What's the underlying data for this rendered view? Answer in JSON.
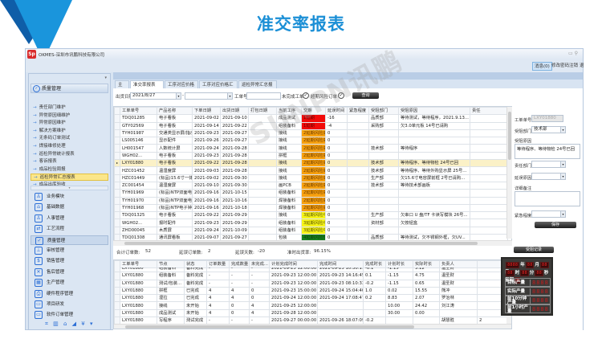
{
  "page_title": "准交率报表",
  "watermark": "SUNPN讯鹏",
  "app": {
    "logo": "Sp",
    "title": "OKMES-深圳市讯鹏科技有限公司",
    "window_controls": "▭ ⚲"
  },
  "menu": [
    {
      "label": "消息(0)"
    },
    {
      "label": "修改密码"
    },
    {
      "label": "注销"
    },
    {
      "label": "退"
    }
  ],
  "sidebar": {
    "pin": "▾",
    "group_label": "质量管理",
    "items": [
      {
        "label": "责任部门维护"
      },
      {
        "label": "异常原因细维护"
      },
      {
        "label": "异常原因维护"
      },
      {
        "label": "解决方案维护"
      },
      {
        "label": "无条码订单测试"
      },
      {
        "label": "焊接维修处理"
      },
      {
        "label": "巡检异常统计报表"
      },
      {
        "label": "客诉报表"
      },
      {
        "label": "成品检验周报"
      },
      {
        "label": "巡检异常汇总报表"
      },
      {
        "label": "成品出库验收"
      }
    ],
    "selected_item": "巡检异常汇总报表",
    "modules": [
      {
        "label": "业务模块",
        "icon": "user-icon",
        "glyph": "♙"
      },
      {
        "label": "基础数据",
        "icon": "home-icon",
        "glyph": "⌂"
      },
      {
        "label": "人事管理",
        "icon": "people-icon",
        "glyph": "♙"
      },
      {
        "label": "工艺流程",
        "icon": "flow-icon",
        "glyph": "⇄"
      },
      {
        "label": "质量管理",
        "icon": "check-icon",
        "glyph": "✓"
      },
      {
        "label": "审核管理",
        "icon": "stamp-icon",
        "glyph": "⊥"
      },
      {
        "label": "销售管理",
        "icon": "money-bag-icon",
        "glyph": "$"
      },
      {
        "label": "售后管理",
        "icon": "tools-icon",
        "glyph": "✕"
      },
      {
        "label": "生产管理",
        "icon": "grid-icon",
        "glyph": "▦"
      },
      {
        "label": "硬件程序管理",
        "icon": "printer-icon",
        "glyph": "⎙"
      },
      {
        "label": "项目研发",
        "icon": "monitor-code-icon",
        "glyph": "▭"
      },
      {
        "label": "软件订单管理",
        "icon": "monitor-icon",
        "glyph": "▭"
      }
    ],
    "bottom_icons": "⌗ ▥ ⌂ ◢ ¥ ▾"
  },
  "tabs": [
    {
      "label": "主页",
      "closable": false
    },
    {
      "label": "准交率报表2",
      "closable": true,
      "active": true
    },
    {
      "label": "工序对应价格",
      "closable": true
    },
    {
      "label": "工序对应价格汇总",
      "closable": true
    },
    {
      "label": "巡检异常汇总报表",
      "closable": true
    }
  ],
  "filter": {
    "ship_date_label": "出货日期",
    "ship_date_from": "2021/8/27",
    "ship_date_to": "",
    "order_no_label": "工单号",
    "order_no_value": "",
    "incomplete_label": "未完成工单",
    "incomplete_checked": true,
    "overdue_label": "超期风险订单",
    "overdue_checked": true,
    "query_button": "查询"
  },
  "orders_table": {
    "columns": [
      "工单单号",
      "产品名称",
      "下单日期",
      "出货日期",
      "打包日期",
      "当前工序",
      "交期",
      "延误时间",
      "紧急程度",
      "受阻部门",
      "受阻原因",
      "责任"
    ],
    "rows": [
      {
        "cells": [
          "TDQ01285",
          "电子看板",
          "2021-09-02",
          "2021-09-10",
          "",
          "成品测试",
          "1延期",
          "-16",
          "",
          "品质部",
          "等待测试，等待程序，2021.9.13...",
          ""
        ],
        "level": 1
      },
      {
        "cells": [
          "GTY02569",
          "电子看板",
          "2021-09-14",
          "2021-09-22",
          "",
          "组装备料",
          "1延期",
          "-4",
          "",
          "采购部",
          "欠3.0单元板  14号已请购",
          ""
        ],
        "level": 1
      },
      {
        "cells": [
          "TYH01987",
          "交通类显示屏/指示...",
          "2021-09-23",
          "2021-09-27",
          "",
          "接线",
          "2延期风险高",
          "0",
          "",
          "",
          "",
          ""
        ],
        "level": 2
      },
      {
        "cells": [
          "LS005146",
          "显示配件",
          "2021-09-26",
          "2021-09-27",
          "",
          "接线",
          "2延期风险高",
          "0",
          "",
          "",
          "",
          ""
        ],
        "level": 2
      },
      {
        "cells": [
          "LH001547",
          "人数统计屏",
          "2021-09-24",
          "2021-09-28",
          "",
          "接线",
          "2延期风险高",
          "0",
          "",
          "技术部",
          "等待程序",
          ""
        ],
        "level": 2
      },
      {
        "cells": [
          "WGH02...",
          "电子看板",
          "2021-09-23",
          "2021-09-28",
          "",
          "拼框",
          "2延期风险高",
          "0",
          "",
          "",
          "",
          ""
        ],
        "level": 2
      },
      {
        "cells": [
          "LXY01880",
          "电子看板",
          "2021-09-22",
          "2021-09-28",
          "",
          "接线",
          "2延期风险高",
          "0",
          "",
          "技术部",
          "等待程序、等待物检 24号已回",
          ""
        ],
        "level": 2,
        "selected": true
      },
      {
        "cells": [
          "HZC01452",
          "温湿度屏",
          "2021-09-03",
          "2021-09-28",
          "",
          "接线",
          "2延期风险高",
          "0",
          "",
          "技术部",
          "等待程序、等待外购显示屏 25号...",
          ""
        ],
        "level": 2
      },
      {
        "cells": [
          "HZC01449",
          "(标品)15.6寸一体...",
          "2021-09-02",
          "2021-09-30",
          "",
          "接线",
          "2延期风险高",
          "0",
          "",
          "生产部",
          "欠15.6寸电容屏前框  2号已请购...",
          ""
        ],
        "level": 2
      },
      {
        "cells": [
          "ZC001454",
          "温湿度屏",
          "2021-09-10",
          "2021-09-30",
          "",
          "画PCB",
          "2延期风险高",
          "0",
          "",
          "技术部",
          "等待技术部画板",
          ""
        ],
        "level": 2
      },
      {
        "cells": [
          "TYH01969",
          "(标品)NTP双面电...",
          "2021-09-16",
          "2021-10-15",
          "",
          "组装备料",
          "2延期风险高",
          "0",
          "",
          "",
          "",
          ""
        ],
        "level": 2
      },
      {
        "cells": [
          "TYH01970",
          "(标品)NTP双面电...",
          "2021-09-16",
          "2021-10-16",
          "",
          "焊接备料",
          "2延期风险高",
          "0",
          "",
          "",
          "",
          ""
        ],
        "level": 2
      },
      {
        "cells": [
          "TYH01968",
          "(标品)NTP电子钟...",
          "2021-09-16",
          "2021-10-18",
          "",
          "焊接备料",
          "2延期风险高",
          "0",
          "",
          "",
          "",
          ""
        ],
        "level": 2
      },
      {
        "cells": [
          "TDQ01325",
          "电子看板",
          "2021-09-22",
          "2021-09-29",
          "",
          "接线",
          "3延期风险中",
          "0",
          "",
          "生产部",
          "欠串口 U 盘/TF 卡读写模块  26号...",
          ""
        ],
        "level": 3
      },
      {
        "cells": [
          "WGH02...",
          "报时配件",
          "2021-09-23",
          "2021-09-29",
          "",
          "组装备料",
          "3延期风险中",
          "0",
          "",
          "资材部",
          "欠按钮盒",
          ""
        ],
        "level": 3
      },
      {
        "cells": [
          "ZHD00045",
          "木质屏",
          "2021-09-24",
          "2021-10-09",
          "",
          "组装备料",
          "3延期风险中",
          "0",
          "",
          "",
          "",
          ""
        ],
        "level": 3
      },
      {
        "cells": [
          "TDQ01308",
          "通讯屏看板",
          "2021-09-07",
          "2021-09-27",
          "",
          "包装",
          "4延期风险低",
          "0",
          "",
          "品质部",
          "等待测试，欠不锈钢外框，欠UV...",
          ""
        ],
        "level": 4
      }
    ]
  },
  "summary": {
    "total_label": "合计订单数:",
    "total": "52",
    "delayed_label": "延误订单数:",
    "delayed": "2",
    "delay_days_label": "延误天数:",
    "delay_days": "-20",
    "ontime_label": "准时出货率:",
    "ontime_rate": "96.15%"
  },
  "process_table": {
    "columns": [
      "工单单号",
      "节点",
      "状态",
      "订单数量",
      "完成数量",
      "未完成...",
      "计划完成时间",
      "完成时间",
      "完成时长",
      "计划时长",
      "实际时长",
      "负责人",
      ""
    ],
    "rows": [
      [
        "LXY01880",
        "组装备料",
        "备料完成",
        "-",
        "-",
        "-",
        "2021-09-23 12:00:00",
        "2021-09-23 10:30:11",
        "-0.1",
        "-1.15",
        "3.12",
        "温圣财",
        ""
      ],
      [
        "LXY01880",
        "组装备料",
        "备料完成",
        "-",
        "-",
        "-",
        "2021-09-23 12:00:00",
        "2021-09-23 14:16:45",
        "0.1",
        "-1.15",
        "4.75",
        "温圣财",
        ""
      ],
      [
        "LXY01880",
        "测试/包装...",
        "备料完成",
        "-",
        "-",
        "-",
        "2021-09-23 12:00:00",
        "2021-09-23 08:10:33",
        "-0.2",
        "-1.15",
        "0.65",
        "温圣财",
        ""
      ],
      [
        "LXY01880",
        "拼框",
        "已完成",
        "4",
        "4",
        "0",
        "2021-09-23 15:00:00",
        "2021-09-24 15:04:40",
        "1.0",
        "0.02",
        "15.55",
        "熊冲",
        ""
      ],
      [
        "LXY01880",
        "湿拉",
        "已完成",
        "4",
        "4",
        "0",
        "2021-09-24 12:00:00",
        "2021-09-24 17:08:47",
        "0.2",
        "8.83",
        "2.07",
        "罗治林",
        ""
      ],
      [
        "LXY01880",
        "接线",
        "未开始",
        "4",
        "0",
        "4",
        "2021-09-25 12:00:00",
        "",
        "",
        "10.00",
        "24.42",
        "刘江涛",
        ""
      ],
      [
        "LXY01880",
        "成品测试",
        "未开始",
        "4",
        "0",
        "4",
        "2021-09-28 12:00:00",
        "",
        "",
        "30.00",
        "0.00",
        "",
        ""
      ],
      [
        "LXY01880",
        "写程序",
        "测试完成",
        "-",
        "-",
        "-",
        "2021-09-27 00:00:00",
        "2021-09-26 18:07:09",
        "-0.2",
        "",
        "",
        "胡慧胜",
        "2"
      ]
    ]
  },
  "detail_form": {
    "order_no_label": "工单单号",
    "order_no_value": "LXY01880",
    "blocked_dept_label": "受阻部门",
    "blocked_dept_value": "技术部",
    "blocked_reason_label": "受阻原因",
    "blocked_reason_value": "等待程序、等待物检 24号已回",
    "resp_dept_label": "责任部门",
    "resp_dept_value": "",
    "delay_reason_label": "延误原因",
    "delay_reason_value": "",
    "remark_label": "详细备注",
    "remark_value": "",
    "urgency_label": "紧急程度",
    "urgency_value": "",
    "save_button": "保存",
    "history_button": "受阻记录"
  },
  "led_board": {
    "year": "8888",
    "year_label": "年",
    "month": "88",
    "month_label": "月",
    "day": "88",
    "day_label": "日",
    "hour": "88",
    "hour_label": "时",
    "minute": "88",
    "minute_label": "分",
    "second": "88",
    "second_label": "秒",
    "week_label": "星期",
    "week": "8",
    "target_label": "目标产量",
    "target": "8888",
    "actual_label": "实际产量",
    "actual": "8888",
    "last10_label": "前10分钟产量",
    "last10": "8888",
    "last1h_label": "前1小时产量",
    "last1h": "8888"
  }
}
